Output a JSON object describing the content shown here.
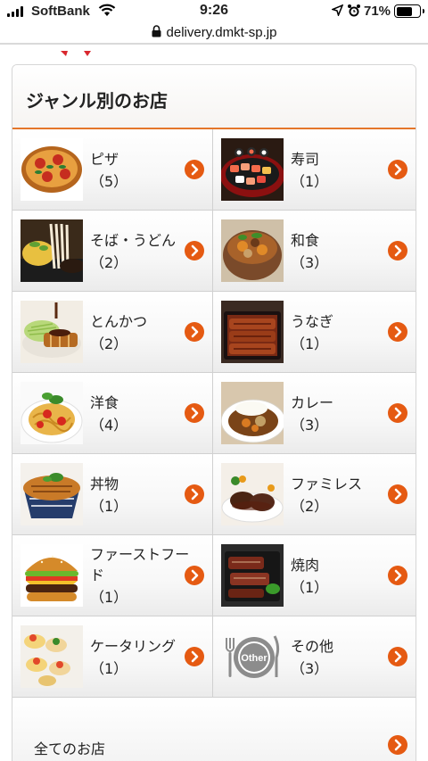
{
  "status": {
    "carrier": "SoftBank",
    "time": "9:26",
    "battery": "71%",
    "battery_level": 0.71,
    "icons": [
      "signal-icon",
      "wifi-icon",
      "location-icon",
      "alarm-icon",
      "battery-icon"
    ]
  },
  "browser": {
    "url": "delivery.dmkt-sp.jp",
    "secure_icon": "lock-icon"
  },
  "panel": {
    "title": "ジャンル別のお店",
    "accent_color": "#e4762a",
    "arrow_color": "#e55a12"
  },
  "genres": [
    {
      "name": "ピザ",
      "count": "（5）",
      "icon": "pizza-photo"
    },
    {
      "name": "寿司",
      "count": "（1）",
      "icon": "sushi-photo"
    },
    {
      "name": "そば・うどん",
      "count": "（2）",
      "icon": "soba-photo"
    },
    {
      "name": "和食",
      "count": "（3）",
      "icon": "washoku-photo"
    },
    {
      "name": "とんかつ",
      "count": "（2）",
      "icon": "tonkatsu-photo"
    },
    {
      "name": "うなぎ",
      "count": "（1）",
      "icon": "unagi-photo"
    },
    {
      "name": "洋食",
      "count": "（4）",
      "icon": "pasta-photo"
    },
    {
      "name": "カレー",
      "count": "（3）",
      "icon": "curry-photo"
    },
    {
      "name": "丼物",
      "count": "（1）",
      "icon": "donburi-photo"
    },
    {
      "name": "ファミレス",
      "count": "（2）",
      "icon": "hamburg-photo"
    },
    {
      "name": "ファーストフード",
      "count": "（1）",
      "icon": "burger-photo"
    },
    {
      "name": "焼肉",
      "count": "（1）",
      "icon": "yakiniku-photo"
    },
    {
      "name": "ケータリング",
      "count": "（1）",
      "icon": "catering-photo"
    },
    {
      "name": "その他",
      "count": "（3）",
      "icon": "other-plate-icon",
      "icon_text": "Other"
    }
  ],
  "all_shops": {
    "label": "全てのお店"
  }
}
